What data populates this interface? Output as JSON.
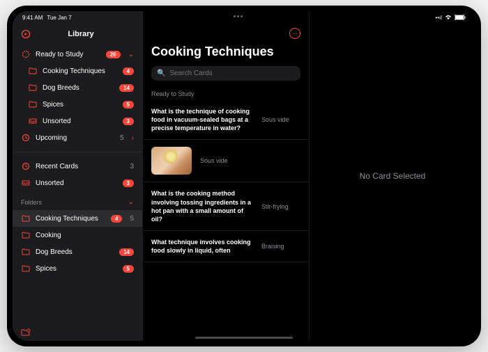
{
  "statusBar": {
    "time": "9:41 AM",
    "date": "Tue Jan 7"
  },
  "sidebar": {
    "title": "Library",
    "readyToStudy": {
      "label": "Ready to Study",
      "count": "26",
      "items": [
        {
          "label": "Cooking Techniques",
          "count": "4"
        },
        {
          "label": "Dog Breeds",
          "count": "14"
        },
        {
          "label": "Spices",
          "count": "5"
        },
        {
          "label": "Unsorted",
          "count": "3"
        }
      ]
    },
    "upcoming": {
      "label": "Upcoming",
      "count": "5"
    },
    "recentCards": {
      "label": "Recent Cards",
      "count": "3"
    },
    "unsorted": {
      "label": "Unsorted",
      "count": "3"
    },
    "foldersHeader": "Folders",
    "folders": [
      {
        "label": "Cooking Techniques",
        "badge": "4",
        "count": "5"
      },
      {
        "label": "Cooking",
        "badge": "",
        "count": ""
      },
      {
        "label": "Dog Breeds",
        "badge": "14",
        "count": ""
      },
      {
        "label": "Spices",
        "badge": "5",
        "count": ""
      }
    ]
  },
  "main": {
    "title": "Cooking Techniques",
    "searchPlaceholder": "Search Cards",
    "listSectionLabel": "Ready to Study",
    "cards": [
      {
        "q": "What is the technique of cooking food in vacuum-sealed bags at a precise temperature in water?",
        "a": "Sous vide"
      },
      {
        "q": "",
        "a": "Sous vide",
        "hasImage": true
      },
      {
        "q": "What is the cooking method involving tossing ingredients in a hot pan with a small amount of oil?",
        "a": "Stir-frying"
      },
      {
        "q": "What technique involves cooking food slowly in liquid, often",
        "a": "Braising"
      }
    ]
  },
  "detail": {
    "emptyText": "No Card Selected"
  }
}
